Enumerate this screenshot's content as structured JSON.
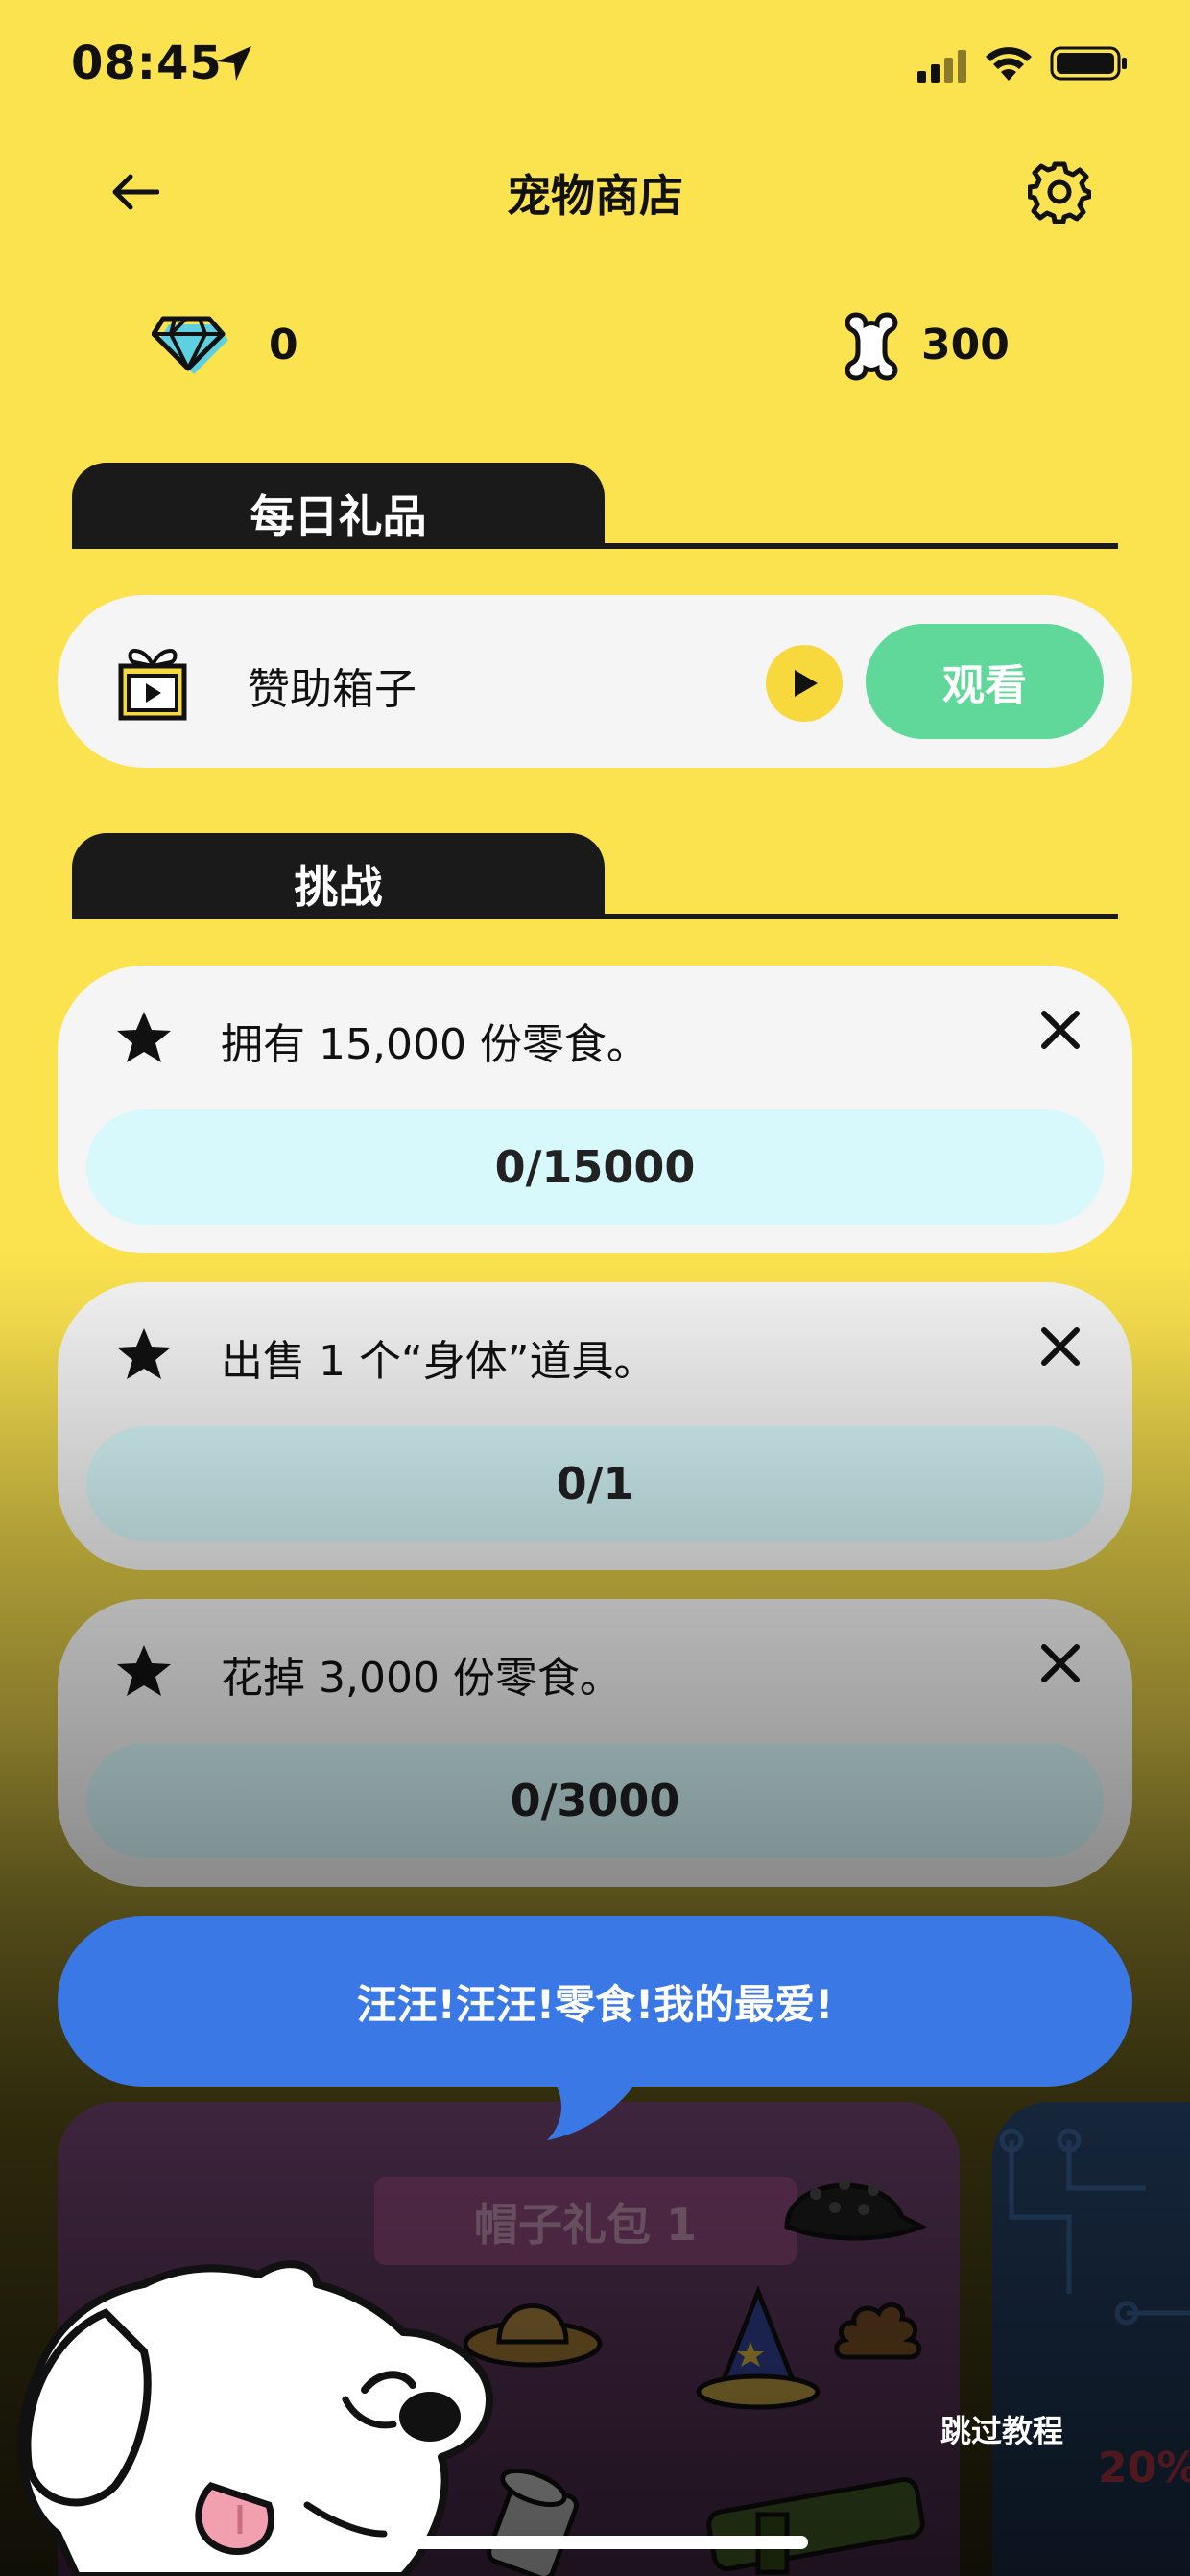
{
  "status_bar": {
    "time": "08:45"
  },
  "header": {
    "title": "宠物商店"
  },
  "currency": {
    "gems": "0",
    "bones": "300"
  },
  "daily_gift": {
    "section_label": "每日礼品",
    "sponsor_label": "赞助箱子",
    "watch_label": "观看"
  },
  "challenges": {
    "section_label": "挑战",
    "items": [
      {
        "text": "拥有 15,000 份零食。",
        "progress": "0/15000",
        "fraction": 0
      },
      {
        "text": "出售 1 个“身体”道具。",
        "progress": "0/1",
        "fraction": 0
      },
      {
        "text": "花掉 3,000 份零食。",
        "progress": "0/3000",
        "fraction": 0
      }
    ]
  },
  "tutorial": {
    "speech": "汪汪!汪汪!零食!我的最爱!",
    "skip_label": "跳过教程"
  },
  "packs": {
    "pack_1_title": "帽子礼包 1",
    "pack_2_discount": "20%"
  },
  "colors": {
    "background": "#fbe34f",
    "watch_button": "#5fd89a",
    "speech_bubble": "#3a78e6",
    "progress_track": "#d8f9fb"
  }
}
